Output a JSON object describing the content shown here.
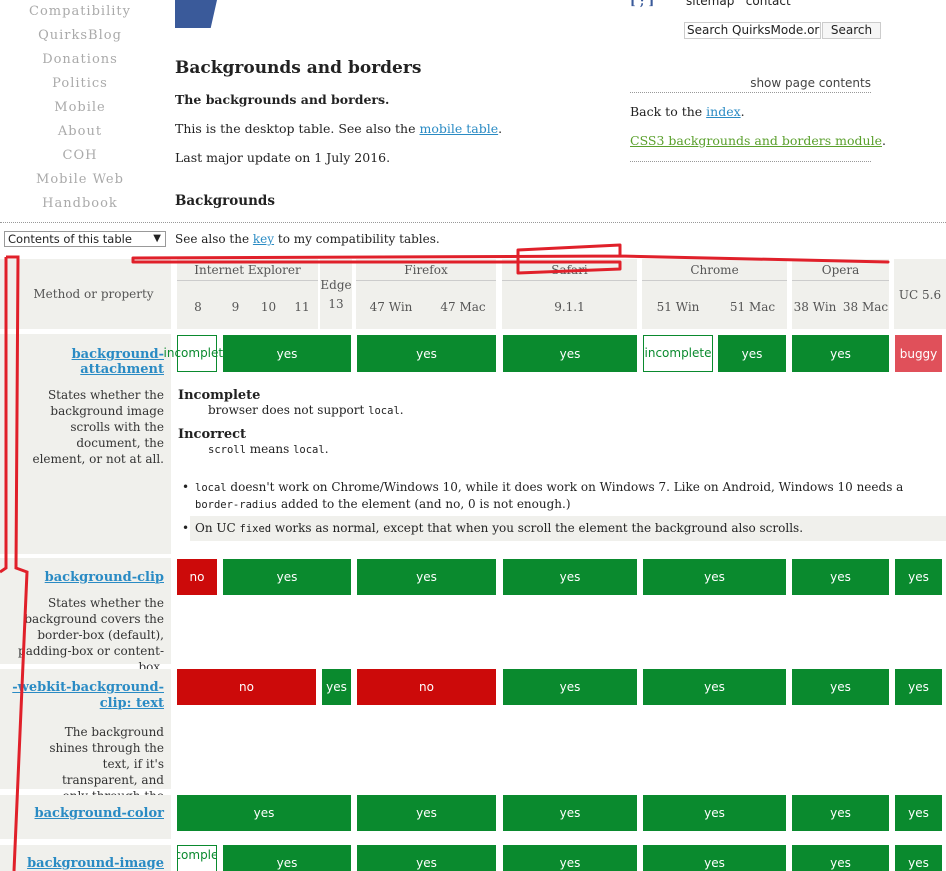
{
  "nav": {
    "items": [
      "Compatibility",
      "QuirksBlog",
      "Donations",
      "Politics",
      "Mobile",
      "About",
      "COH",
      "Mobile Web",
      "Handbook"
    ]
  },
  "header": {
    "title": "Backgrounds and borders",
    "intro_bold": "The backgrounds and borders.",
    "intro1_pre": "This is the desktop table. See also the ",
    "intro1_link": "mobile table",
    "intro1_post": ".",
    "intro2": "Last major update on 1 July 2016.",
    "section": "Backgrounds"
  },
  "rightbox": {
    "brackets": "[ ; ]",
    "sitemap": "sitemap",
    "contact": "contact",
    "search_value": "Search QuirksMode.or",
    "search_button": "Search",
    "show_contents": "show page contents",
    "back_pre": "Back to the ",
    "back_link": "index",
    "back_post": ".",
    "css3_link": "CSS3 backgrounds and borders module",
    "css3_post": "."
  },
  "contents_select": {
    "label": "Contents of this table",
    "arrow": "▼"
  },
  "seealso": {
    "pre": "See also the ",
    "link": "key",
    "post": " to my compatibility tables."
  },
  "table": {
    "method_label": "Method or property",
    "browsers": {
      "ie": "Internet Explorer",
      "edge": "Edge",
      "firefox": "Firefox",
      "safari": "Safari",
      "chrome": "Chrome",
      "opera": "Opera"
    },
    "versions": {
      "ie8": "8",
      "ie9": "9",
      "ie10": "10",
      "ie11": "11",
      "edge13": "13",
      "ff_win": "47 Win",
      "ff_mac": "47 Mac",
      "safari": "9.1.1",
      "ch_win": "51 Win",
      "ch_mac": "51 Mac",
      "op_win": "38 Win",
      "op_mac": "38 Mac",
      "uc": "UC 5.6"
    },
    "rows": {
      "attachment": {
        "name": "background-attachment",
        "desc": "States whether the background image scrolls with the document, the element, or not at all.",
        "ie": "incomplete",
        "ie_rest": "yes",
        "firefox": "yes",
        "safari": "yes",
        "chrome_win": "incomplete",
        "chrome_mac": "yes",
        "opera": "yes",
        "uc": "buggy"
      },
      "clip": {
        "name": "background-clip",
        "desc": "States whether the background covers the border-box (default), padding-box or content-box.",
        "ie8": "no",
        "ie_rest": "yes",
        "firefox": "yes",
        "safari": "yes",
        "chrome": "yes",
        "opera": "yes",
        "uc": "yes"
      },
      "webkit": {
        "name": "-webkit-background-clip: text",
        "desc": "The background shines through the text, if it's transparent, and only through the text.",
        "ie": "no",
        "edge": "yes",
        "firefox": "no",
        "safari": "yes",
        "chrome": "yes",
        "opera": "yes",
        "uc": "yes"
      },
      "color": {
        "name": "background-color",
        "ie_edge": "yes",
        "firefox": "yes",
        "safari": "yes",
        "chrome": "yes",
        "opera": "yes",
        "uc": "yes"
      },
      "image": {
        "name": "background-image",
        "ie8": "incomplete",
        "ie_rest": "yes",
        "firefox": "yes",
        "safari": "yes",
        "chrome": "yes",
        "opera": "yes",
        "uc": "yes"
      }
    },
    "notes": {
      "incomplete_h": "Incomplete",
      "incomplete_pre": "browser does not support ",
      "incomplete_code": "local",
      "incomplete_post": ".",
      "incorrect_h": "Incorrect",
      "incorrect_code1": "scroll",
      "incorrect_mid": " means ",
      "incorrect_code2": "local",
      "incorrect_post": ".",
      "b1_code": "local",
      "b1_text": " doesn't work on Chrome/Windows 10, while it does work on Windows 7. Like on Android, Windows 10 needs a ",
      "b1_code2": "border-radius",
      "b1_text2": " added to the element (and no, 0 is not enough.)",
      "b2_pre": "On UC ",
      "b2_code": "fixed",
      "b2_post": " works as normal, except that when you scroll the element the background also scrolls."
    }
  },
  "colors": {
    "yes": "#0a8a2e",
    "no": "#cc0a0a",
    "buggy": "#e0505a",
    "link": "#2a8bc4",
    "annotation": "#e0202a"
  }
}
